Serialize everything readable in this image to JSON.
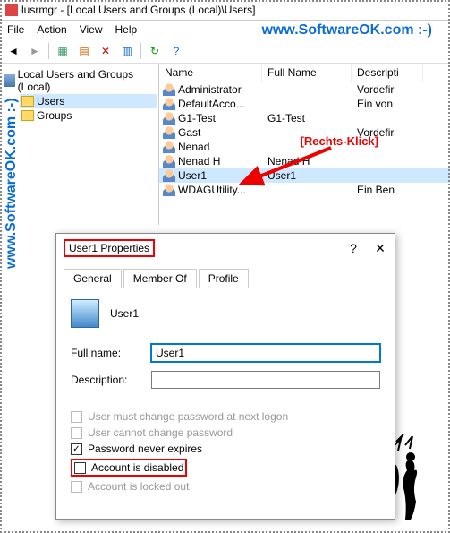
{
  "title": "lusrmgr - [Local Users and Groups (Local)\\Users]",
  "menu": {
    "file": "File",
    "action": "Action",
    "view": "View",
    "help": "Help"
  },
  "watermark": "www.SoftwareOK.com :-)",
  "tree": {
    "root": "Local Users and Groups (Local)",
    "users": "Users",
    "groups": "Groups"
  },
  "list": {
    "head": {
      "name": "Name",
      "full": "Full Name",
      "desc": "Descripti"
    },
    "rows": [
      {
        "name": "Administrator",
        "full": "",
        "desc": "Vordefir"
      },
      {
        "name": "DefaultAcco...",
        "full": "",
        "desc": "Ein von"
      },
      {
        "name": "G1-Test",
        "full": "G1-Test",
        "desc": ""
      },
      {
        "name": "Gast",
        "full": "",
        "desc": "Vordefir"
      },
      {
        "name": "Nenad",
        "full": "",
        "desc": ""
      },
      {
        "name": "Nenad H",
        "full": "Nenad H",
        "desc": ""
      },
      {
        "name": "User1",
        "full": "User1",
        "desc": ""
      },
      {
        "name": "WDAGUtility...",
        "full": "",
        "desc": "Ein Ben"
      }
    ]
  },
  "annotation": "[Rechts-Klick]",
  "dialog": {
    "title": "User1 Properties",
    "tabs": {
      "general": "General",
      "member": "Member Of",
      "profile": "Profile"
    },
    "username": "User1",
    "fullname_label": "Full name:",
    "fullname_value": "User1",
    "desc_label": "Description:",
    "desc_value": "",
    "chk_mustchange": "User must change password at next logon",
    "chk_cannot": "User cannot change password",
    "chk_never": "Password never expires",
    "chk_disabled": "Account is disabled",
    "chk_locked": "Account is locked out"
  }
}
